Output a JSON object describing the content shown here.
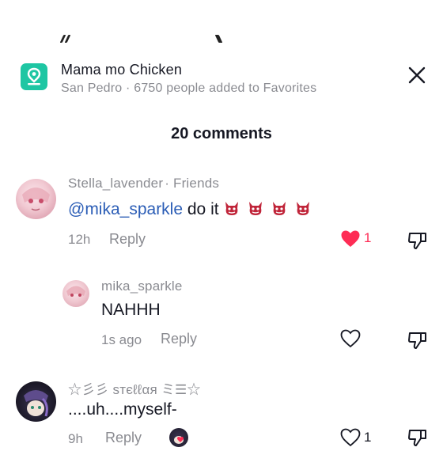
{
  "banner": {
    "title": "Mama mo Chicken",
    "subtitle": "San Pedro · 6750 people added to Favorites",
    "icon": "location-pin-icon",
    "accent": "#1ec6a3"
  },
  "comments_header": "20 comments",
  "comments": [
    {
      "username": "Stella_lavender",
      "relation": "· Friends",
      "mention": "@mika_sparkle",
      "text": "do it",
      "time": "12h",
      "reply_label": "Reply",
      "likes": "1",
      "liked": true
    },
    {
      "username": "mika_sparkle",
      "text": "NAHHH",
      "time": "1s ago",
      "reply_label": "Reply",
      "liked": false
    },
    {
      "username": "☆彡彡 ѕтєℓℓαя ミ☰☆",
      "text": "....uh....myself-",
      "time": "9h",
      "reply_label": "Reply",
      "likes": "1",
      "liked": false
    }
  ],
  "colors": {
    "like_red": "#fe2c55",
    "mention_blue": "#2b5db6",
    "secondary_text": "#8a8b91"
  }
}
